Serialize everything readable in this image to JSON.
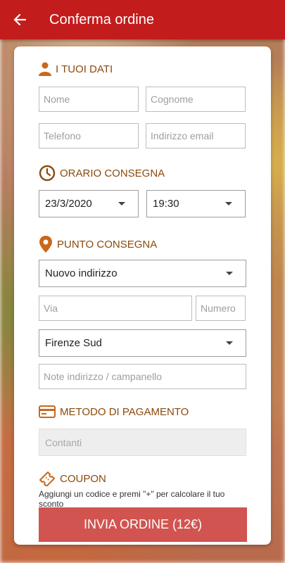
{
  "appbar": {
    "title": "Conferma ordine",
    "back_icon": "arrow-back-icon"
  },
  "personal": {
    "title": "I TUOI DATI",
    "icon": "person-icon",
    "name_placeholder": "Nome",
    "surname_placeholder": "Cognome",
    "phone_placeholder": "Telefono",
    "email_placeholder": "Indirizzo email"
  },
  "delivery_time": {
    "title": "ORARIO CONSEGNA",
    "icon": "clock-icon",
    "date": "23/3/2020",
    "time": "19:30"
  },
  "delivery_point": {
    "title": "PUNTO CONSEGNA",
    "icon": "location-pin-icon",
    "address_option": "Nuovo indirizzo",
    "street_placeholder": "Via",
    "number_placeholder": "Numero",
    "zone": "Firenze Sud",
    "notes_placeholder": "Note indirizzo / campanello"
  },
  "payment": {
    "title": "METODO DI PAGAMENTO",
    "icon": "credit-card-icon",
    "method": "Contanti"
  },
  "coupon": {
    "title": "COUPON",
    "icon": "ticket-icon",
    "hint": "Aggiungi un codice e premi \"+\" per calcolare il tuo sconto"
  },
  "submit": {
    "label": "INVIA ORDINE (12€)"
  },
  "colors": {
    "appbar": "#c31c1c",
    "section_title": "#8a4a0c",
    "submit": "#d15450"
  }
}
